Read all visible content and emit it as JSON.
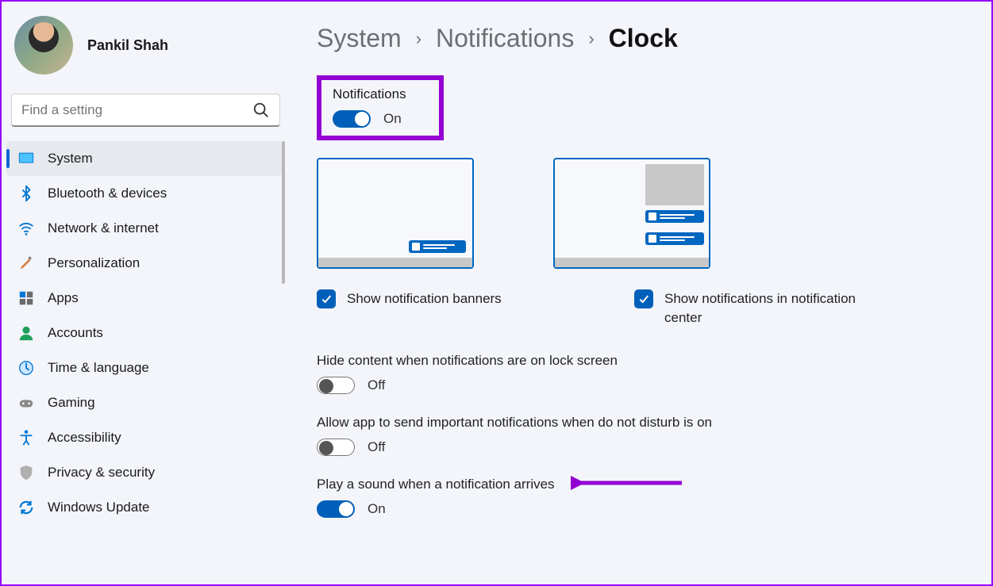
{
  "profile": {
    "name": "Pankil Shah"
  },
  "search": {
    "placeholder": "Find a setting"
  },
  "sidebar": {
    "items": [
      {
        "label": "System",
        "active": true
      },
      {
        "label": "Bluetooth & devices"
      },
      {
        "label": "Network & internet"
      },
      {
        "label": "Personalization"
      },
      {
        "label": "Apps"
      },
      {
        "label": "Accounts"
      },
      {
        "label": "Time & language"
      },
      {
        "label": "Gaming"
      },
      {
        "label": "Accessibility"
      },
      {
        "label": "Privacy & security"
      },
      {
        "label": "Windows Update"
      }
    ]
  },
  "breadcrumb": {
    "part1": "System",
    "part2": "Notifications",
    "part3": "Clock"
  },
  "notifications": {
    "section_label": "Notifications",
    "master_state": "On",
    "banners_label": "Show notification banners",
    "center_label": "Show notifications in notification center",
    "hide_lock_label": "Hide content when notifications are on lock screen",
    "hide_lock_state": "Off",
    "dnd_label": "Allow app to send important notifications when do not disturb is on",
    "dnd_state": "Off",
    "sound_label": "Play a sound when a notification arrives",
    "sound_state": "On"
  }
}
